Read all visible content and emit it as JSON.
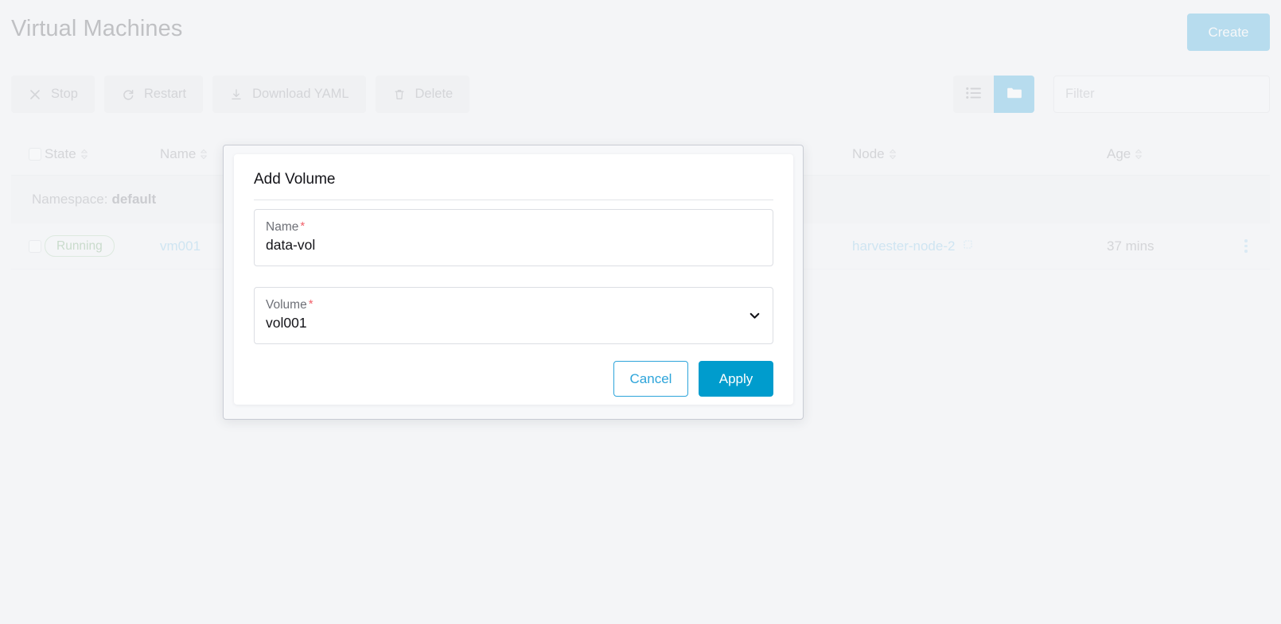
{
  "header": {
    "title": "Virtual Machines",
    "create_label": "Create"
  },
  "toolbar": {
    "actions": [
      {
        "label": "Stop",
        "icon": "close-icon"
      },
      {
        "label": "Restart",
        "icon": "refresh-icon"
      },
      {
        "label": "Download YAML",
        "icon": "download-icon"
      },
      {
        "label": "Delete",
        "icon": "trash-icon"
      }
    ]
  },
  "view_toggle": {
    "list_icon": "list-view-icon",
    "group_icon": "folder-group-view-icon",
    "active": "group"
  },
  "search": {
    "placeholder": "Filter",
    "value": ""
  },
  "table": {
    "columns": [
      {
        "key": "state",
        "label": "State"
      },
      {
        "key": "name",
        "label": "Name"
      },
      {
        "key": "node",
        "label": "Node"
      },
      {
        "key": "age",
        "label": "Age"
      }
    ],
    "group": {
      "prefix": "Namespace:",
      "value": "default"
    },
    "rows": [
      {
        "state": "Running",
        "name": "vm001",
        "node": "harvester-node-2",
        "age": "37 mins"
      }
    ]
  },
  "modal": {
    "title": "Add Volume",
    "fields": [
      {
        "label": "Name",
        "required_mark": "*",
        "value": "data-vol",
        "type": "text"
      },
      {
        "label": "Volume",
        "required_mark": "*",
        "value": "vol001",
        "type": "select"
      }
    ],
    "cancel_label": "Cancel",
    "apply_label": "Apply"
  },
  "colors": {
    "accent": "#2da4da",
    "apply": "#009ccd",
    "required": "#f1606a",
    "running_badge": "#6aa06a",
    "link": "#7cc2e8",
    "page_bg": "#f4f5f7"
  }
}
